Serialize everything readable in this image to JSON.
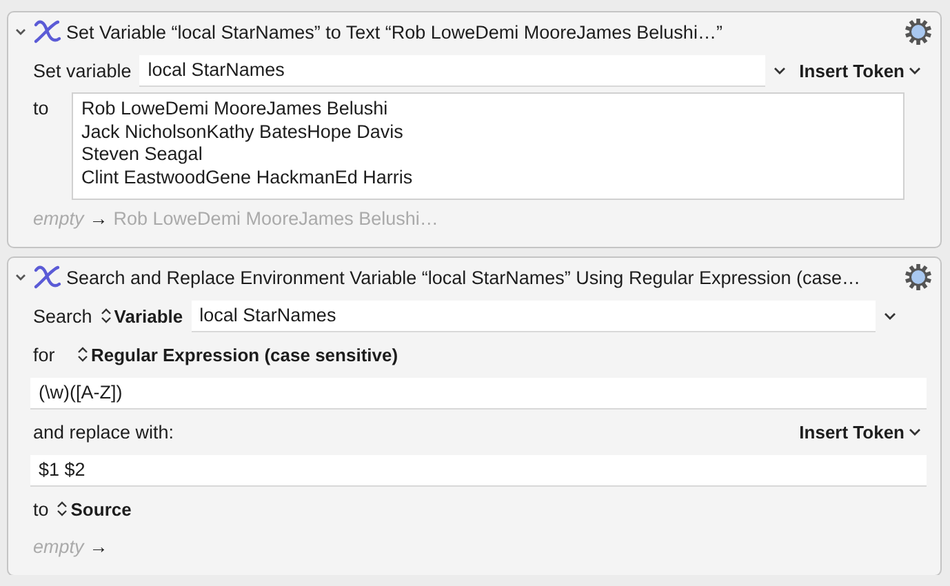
{
  "actions": [
    {
      "kind": "set_variable",
      "expanded": true,
      "title": "Set Variable “local StarNames” to Text “Rob LoweDemi MooreJames Belushi…”",
      "variable_label": "Set variable",
      "variable": "local StarNames",
      "insert_token": "Insert Token",
      "to_label": "to",
      "text_lines": [
        "Rob LoweDemi MooreJames Belushi",
        "Jack NicholsonKathy BatesHope Davis",
        "Steven Seagal",
        "Clint EastwoodGene HackmanEd Harris"
      ],
      "result_before": "empty",
      "result_arrow": "→",
      "result_after": "Rob LoweDemi MooreJames Belushi…"
    },
    {
      "kind": "search_replace",
      "expanded": true,
      "title": "Search and Replace Environment Variable “local StarNames” Using Regular Expression (case…",
      "search_label": "Search",
      "search_source": "Variable",
      "variable": "local StarNames",
      "for_label": "for",
      "for_mode": "Regular Expression (case sensitive)",
      "pattern": "(\\w)([A-Z])",
      "replace_label": "and replace with:",
      "insert_token": "Insert Token",
      "replacement": "$1 $2",
      "to_label": "to",
      "to_target": "Source",
      "result_before": "empty",
      "result_arrow": "→"
    }
  ]
}
